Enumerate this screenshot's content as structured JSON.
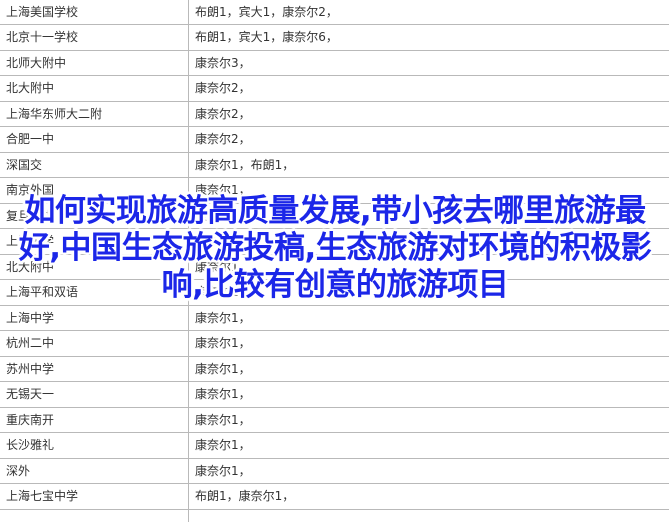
{
  "rows": [
    {
      "school": "上海美国学校",
      "people": "布朗1，宾大1，康奈尔2，"
    },
    {
      "school": "北京十一学校",
      "people": "布朗1，宾大1，康奈尔6，"
    },
    {
      "school": "北师大附中",
      "people": "康奈尔3，"
    },
    {
      "school": "北大附中",
      "people": "康奈尔2，"
    },
    {
      "school": "上海华东师大二附",
      "people": "康奈尔2，"
    },
    {
      "school": "合肥一中",
      "people": "康奈尔2，"
    },
    {
      "school": "深国交",
      "people": "康奈尔1，布朗1，"
    },
    {
      "school": "南京外国",
      "people": "康奈尔1，"
    },
    {
      "school": "复旦附中",
      "people": "康奈尔1，"
    },
    {
      "school": "上海中学",
      "people": "康奈尔1，"
    },
    {
      "school": "北大附中",
      "people": "康奈尔1，"
    },
    {
      "school": "上海平和双语",
      "people": "康奈尔1，"
    },
    {
      "school": "上海中学",
      "people": "康奈尔1，"
    },
    {
      "school": "杭州二中",
      "people": "康奈尔1，"
    },
    {
      "school": "苏州中学",
      "people": "康奈尔1，"
    },
    {
      "school": "无锡天一",
      "people": "康奈尔1，"
    },
    {
      "school": "重庆南开",
      "people": "康奈尔1，"
    },
    {
      "school": "长沙雅礼",
      "people": "康奈尔1，"
    },
    {
      "school": "深外",
      "people": "康奈尔1，"
    },
    {
      "school": "上海七宝中学",
      "people": "布朗1，康奈尔1，"
    },
    {
      "school": "",
      "people": ""
    }
  ],
  "overlay_text": "如何实现旅游高质量发展,带小孩去哪里旅游最好,中国生态旅游投稿,生态旅游对环境的积极影响,比较有创意的旅游项目"
}
